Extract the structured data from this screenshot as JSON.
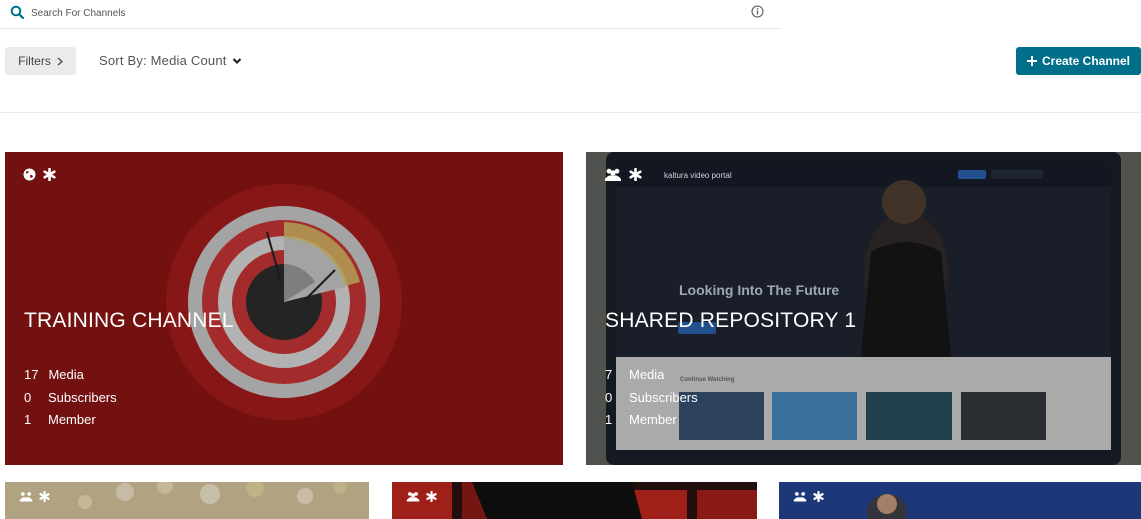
{
  "search": {
    "placeholder": "Search For Channels",
    "value": ""
  },
  "filters": {
    "label": "Filters",
    "chevron": "chevron-right-icon"
  },
  "sort": {
    "label": "Sort By: Media Count",
    "icon": "chevron-down-icon"
  },
  "create": {
    "label": "Create Channel",
    "icon": "plus-icon"
  },
  "colors": {
    "accent": "#00708a",
    "filter_bg": "#ebebeb"
  },
  "channels": [
    {
      "title": "TRAINING CHANNEL",
      "icons": [
        "globe-icon",
        "asterisk-icon"
      ],
      "stats": [
        {
          "num": "17",
          "label": "Media"
        },
        {
          "num": "0",
          "label": "Subscribers"
        },
        {
          "num": "1",
          "label": "Member"
        }
      ]
    },
    {
      "title": "SHARED REPOSITORY 1",
      "icons": [
        "group-icon",
        "asterisk-icon"
      ],
      "stats": [
        {
          "num": "7",
          "label": "Media"
        },
        {
          "num": "0",
          "label": "Subscribers"
        },
        {
          "num": "1",
          "label": "Member"
        }
      ],
      "thumbnail_text": {
        "brand": "kaltura video portal",
        "headline": "Looking Into The Future",
        "section": "Continue Watching"
      }
    },
    {
      "title": "",
      "icons": [
        "group-icon",
        "asterisk-icon"
      ]
    },
    {
      "title": "",
      "icons": [
        "group-icon",
        "asterisk-icon"
      ]
    },
    {
      "title": "",
      "icons": [
        "group-icon",
        "asterisk-icon"
      ]
    }
  ]
}
